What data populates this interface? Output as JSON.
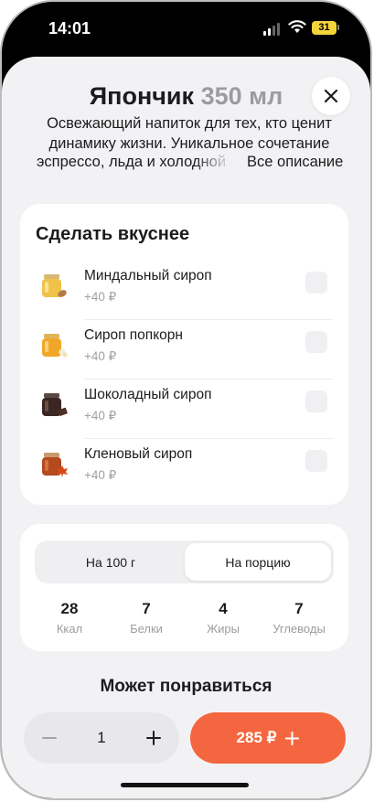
{
  "status": {
    "time": "14:01",
    "battery": "31"
  },
  "product": {
    "name": "Япончик",
    "volume": "350 мл",
    "description": "Освежающий напиток для тех, кто ценит динамику жизни. Уникальное сочетание",
    "description_cut": "эспрессо, льда и холодной во",
    "more_link": "Все описание"
  },
  "addons": {
    "title": "Сделать вкуснее",
    "items": [
      {
        "name": "Миндальный сироп",
        "price": "+40 ₽",
        "checked": false,
        "icon": "almond-syrup-jar-icon"
      },
      {
        "name": "Сироп попкорн",
        "price": "+40 ₽",
        "checked": false,
        "icon": "popcorn-syrup-jar-icon"
      },
      {
        "name": "Шоколадный сироп",
        "price": "+40 ₽",
        "checked": false,
        "icon": "chocolate-syrup-jar-icon"
      },
      {
        "name": "Кленовый сироп",
        "price": "+40 ₽",
        "checked": false,
        "icon": "maple-syrup-jar-icon"
      }
    ]
  },
  "nutrition": {
    "tabs": [
      {
        "label": "На 100 г",
        "selected": false
      },
      {
        "label": "На порцию",
        "selected": true
      }
    ],
    "values": [
      {
        "value": "28",
        "label": "Ккал"
      },
      {
        "value": "7",
        "label": "Белки"
      },
      {
        "value": "4",
        "label": "Жиры"
      },
      {
        "value": "7",
        "label": "Углеводы"
      }
    ]
  },
  "recommend": {
    "title": "Может понравиться"
  },
  "cart": {
    "quantity": "1",
    "price_label": "285 ₽"
  },
  "colors": {
    "accent": "#f4663f",
    "background": "#f2f2f4",
    "muted": "#9c9c9f"
  }
}
